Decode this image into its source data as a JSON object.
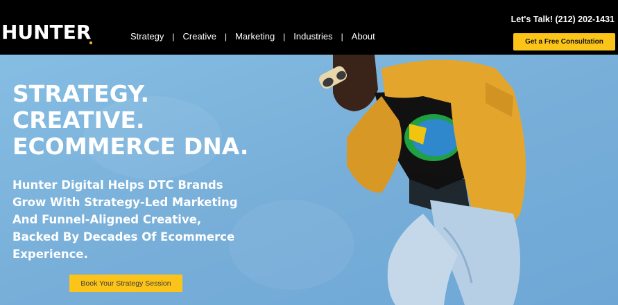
{
  "brand": {
    "logo_text": "HUNTER"
  },
  "nav": {
    "items": [
      {
        "label": "Strategy"
      },
      {
        "label": "Creative"
      },
      {
        "label": "Marketing"
      },
      {
        "label": "Industries"
      },
      {
        "label": "About"
      }
    ],
    "separator": "|"
  },
  "header": {
    "talk_text": "Let's Talk! (212) 202-1431",
    "consult_label": "Get a Free Consultation"
  },
  "hero": {
    "headline_line1": "STRATEGY.",
    "headline_line2": "CREATIVE.",
    "headline_line3": "ECOMMERCE DNA.",
    "subheadline": "Hunter Digital Helps DTC Brands Grow With Strategy-Led Marketing And Funnel-Aligned Creative, Backed By Decades Of Ecommerce Experience.",
    "cta_label": "Book Your Strategy Session"
  },
  "colors": {
    "header_bg": "#000000",
    "accent": "#fcc419",
    "hero_bg": "#7fb6df",
    "text_light": "#ffffff"
  },
  "icons": {
    "hero_image": "person-jumping-yellow-jacket-image"
  }
}
